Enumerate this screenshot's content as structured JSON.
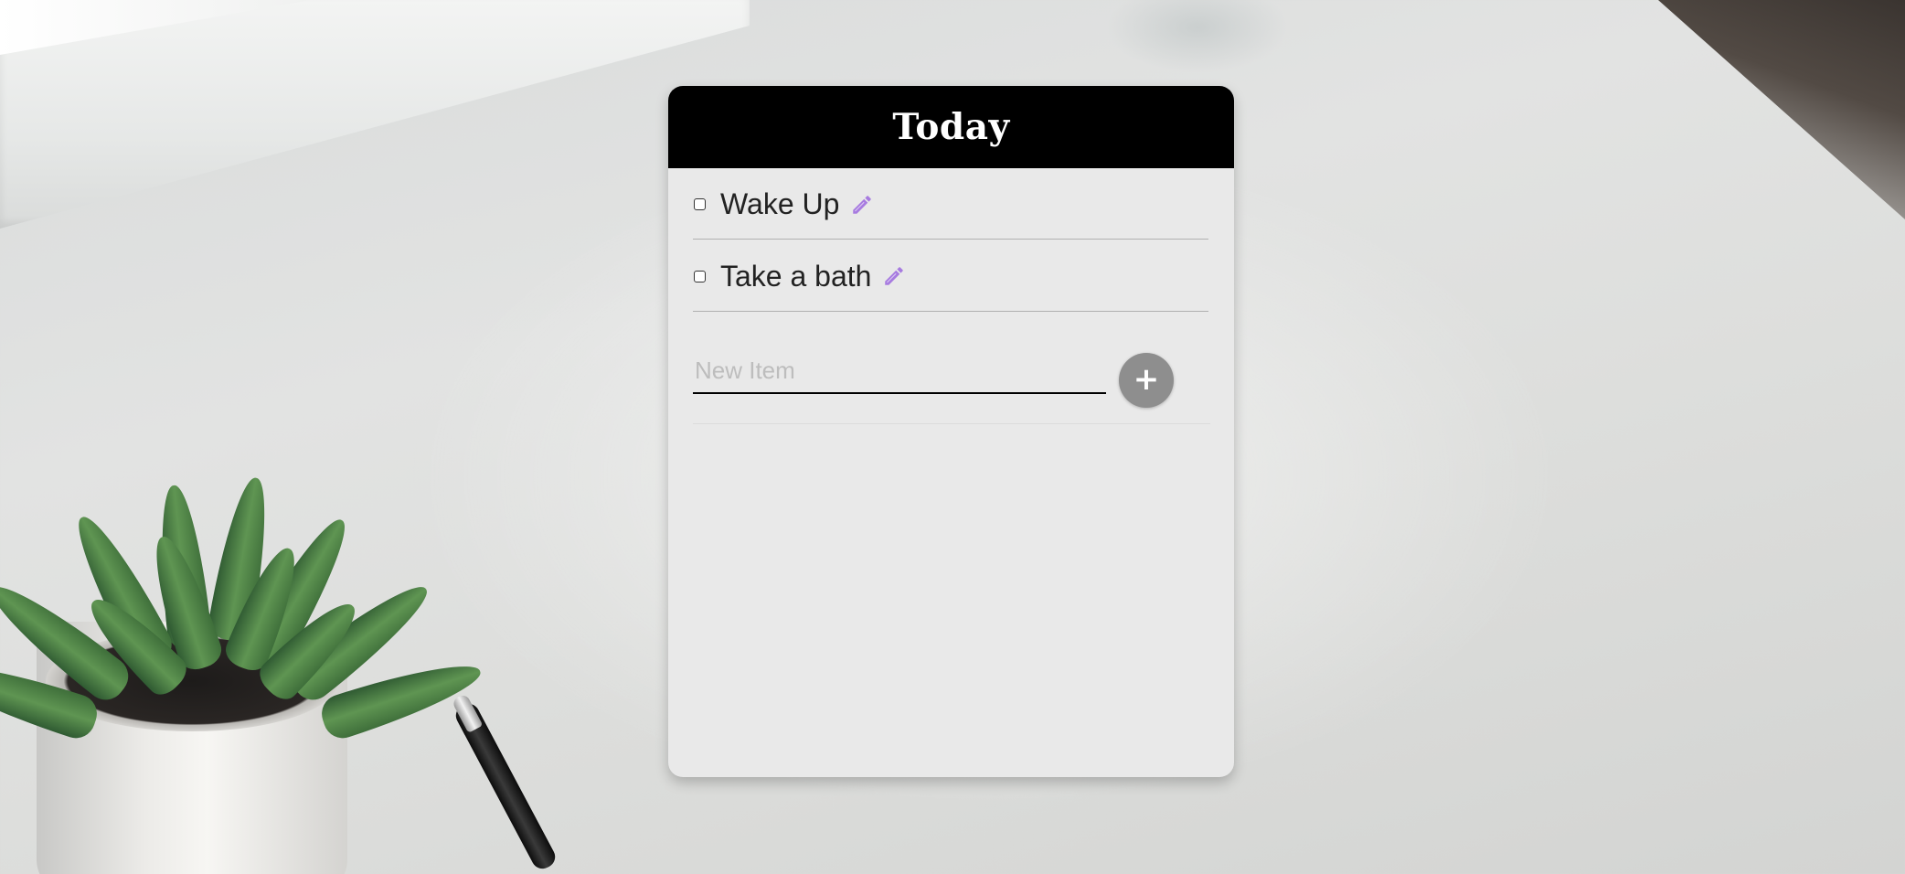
{
  "card": {
    "title": "Today",
    "header_color": "#000000",
    "background_color": "#e9e9e9"
  },
  "items": [
    {
      "label": "Wake Up",
      "checked": false,
      "edit_icon": "pencil-icon"
    },
    {
      "label": "Take a bath",
      "checked": false,
      "edit_icon": "pencil-icon"
    }
  ],
  "new_item": {
    "placeholder": "New Item",
    "value": "",
    "add_button_icon": "plus-icon",
    "add_button_color": "#8e8e8e"
  },
  "accent": {
    "pencil_color": "#a77be0"
  }
}
